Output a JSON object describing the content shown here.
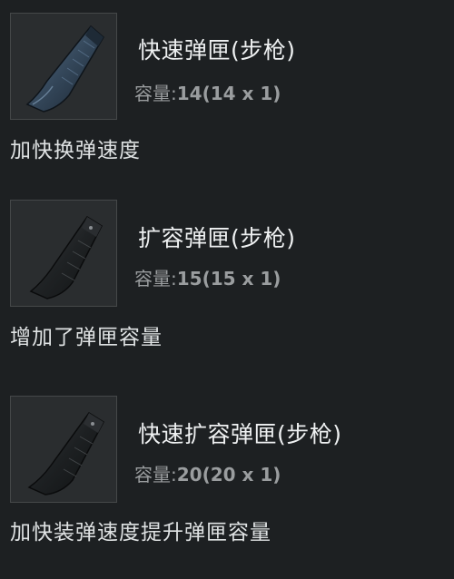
{
  "items": [
    {
      "name": "快速弹匣(步枪)",
      "capacity_label": "容量:",
      "capacity_value": "14(14 x 1)",
      "description": "加快换弹速度",
      "icon": "quickdraw-magazine-icon"
    },
    {
      "name": "扩容弹匣(步枪)",
      "capacity_label": "容量:",
      "capacity_value": "15(15 x 1)",
      "description": "增加了弹匣容量",
      "icon": "extended-magazine-icon"
    },
    {
      "name": "快速扩容弹匣(步枪)",
      "capacity_label": "容量:",
      "capacity_value": "20(20 x 1)",
      "description": "加快装弹速度提升弹匣容量",
      "icon": "extended-quickdraw-magazine-icon"
    }
  ],
  "colors": {
    "background": "#1d2022",
    "thumb_background": "#2a2d2f",
    "thumb_border": "#454849",
    "name_text": "#eef0f1",
    "capacity_text": "#9a9d9f",
    "description_text": "#dfe2e3"
  }
}
